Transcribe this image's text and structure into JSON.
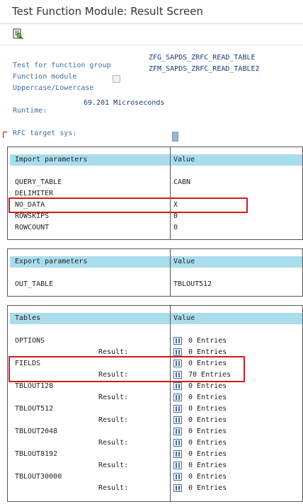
{
  "window": {
    "title": "Test Function Module: Result Screen"
  },
  "toolbar": {
    "execute_icon": "execute-icon"
  },
  "info": {
    "test_label": "Test for function group",
    "test_value": "ZFG_SAPDS_ZRFC_READ_TABLE",
    "module_label": "Function module",
    "module_value": "ZFM_SAPDS_ZRFC_READ_TABLE2",
    "case_label": "Uppercase/Lowercase",
    "case_checked": false,
    "runtime_label": "Runtime:",
    "runtime_value": "69.201 Microseconds",
    "rfc_label": "RFC target sys:"
  },
  "import": {
    "col1": "Import parameters",
    "col2": "Value",
    "rows": [
      {
        "name": "QUERY_TABLE",
        "value": "CABN"
      },
      {
        "name": "DELIMITER",
        "value": ""
      },
      {
        "name": "NO_DATA",
        "value": "X",
        "highlighted": true
      },
      {
        "name": "ROWSKIPS",
        "value": "0"
      },
      {
        "name": "ROWCOUNT",
        "value": "0"
      }
    ]
  },
  "export": {
    "col1": "Export parameters",
    "col2": "Value",
    "rows": [
      {
        "name": "OUT_TABLE",
        "value": "TBLOUT512"
      }
    ]
  },
  "tables": {
    "col1": "Tables",
    "col2": "Value",
    "result_label": "Result:",
    "rows": [
      {
        "name": "OPTIONS",
        "entries": "0 Entries",
        "result_entries": "0 Entries"
      },
      {
        "name": "FIELDS",
        "entries": "0 Entries",
        "result_entries": "70 Entries",
        "highlighted": true
      },
      {
        "name": "TBLOUT128",
        "entries": "0 Entries",
        "result_entries": "0 Entries"
      },
      {
        "name": "TBLOUT512",
        "entries": "0 Entries",
        "result_entries": "0 Entries"
      },
      {
        "name": "TBLOUT2048",
        "entries": "0 Entries",
        "result_entries": "0 Entries"
      },
      {
        "name": "TBLOUT8192",
        "entries": "0 Entries",
        "result_entries": "0 Entries"
      },
      {
        "name": "TBLOUT30000",
        "entries": "0 Entries",
        "result_entries": "0 Entries"
      }
    ]
  },
  "colors": {
    "header_bg": "#a9dced",
    "label_blue": "#3d6fa3",
    "highlight_red": "#d11a1a"
  }
}
